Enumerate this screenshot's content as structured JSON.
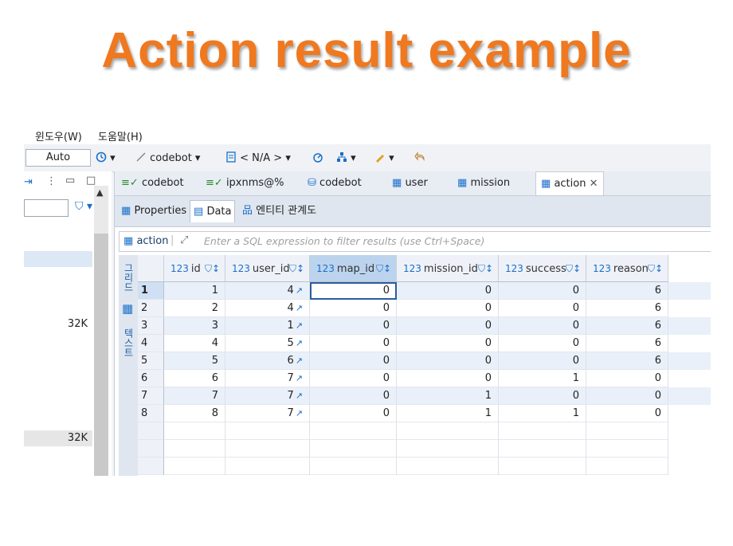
{
  "slide_title": "Action result example",
  "menu": {
    "window": "윈도우(W)",
    "help": "도움말(H)"
  },
  "toolbar": {
    "auto": "Auto",
    "connection": "codebot",
    "schema": "< N/A >"
  },
  "left_panel": {
    "value_1": "32K",
    "value_2": "32K"
  },
  "editor_tabs": [
    {
      "label": "codebot"
    },
    {
      "label": "ipxnms@%"
    },
    {
      "label": "codebot"
    },
    {
      "label": "user"
    },
    {
      "label": "mission"
    },
    {
      "label": "action"
    }
  ],
  "sub_tabs": {
    "properties": "Properties",
    "data": "Data",
    "er": "엔티티 관계도"
  },
  "filter": {
    "table": "action",
    "placeholder": "Enter a SQL expression to filter results (use Ctrl+Space)"
  },
  "side_labels": {
    "grid": "그리드",
    "text": "텍스트"
  },
  "columns": [
    {
      "type": "123",
      "name": "id"
    },
    {
      "type": "123",
      "name": "user_id"
    },
    {
      "type": "123",
      "name": "map_id"
    },
    {
      "type": "123",
      "name": "mission_id"
    },
    {
      "type": "123",
      "name": "success"
    },
    {
      "type": "123",
      "name": "reason"
    }
  ],
  "rows": [
    {
      "n": "1",
      "id": "1",
      "user_id": "4",
      "map_id": "0",
      "mission_id": "0",
      "success": "0",
      "reason": "6"
    },
    {
      "n": "2",
      "id": "2",
      "user_id": "4",
      "map_id": "0",
      "mission_id": "0",
      "success": "0",
      "reason": "6"
    },
    {
      "n": "3",
      "id": "3",
      "user_id": "1",
      "map_id": "0",
      "mission_id": "0",
      "success": "0",
      "reason": "6"
    },
    {
      "n": "4",
      "id": "4",
      "user_id": "5",
      "map_id": "0",
      "mission_id": "0",
      "success": "0",
      "reason": "6"
    },
    {
      "n": "5",
      "id": "5",
      "user_id": "6",
      "map_id": "0",
      "mission_id": "0",
      "success": "0",
      "reason": "6"
    },
    {
      "n": "6",
      "id": "6",
      "user_id": "7",
      "map_id": "0",
      "mission_id": "0",
      "success": "1",
      "reason": "0"
    },
    {
      "n": "7",
      "id": "7",
      "user_id": "7",
      "map_id": "0",
      "mission_id": "1",
      "success": "0",
      "reason": "0"
    },
    {
      "n": "8",
      "id": "8",
      "user_id": "7",
      "map_id": "0",
      "mission_id": "1",
      "success": "1",
      "reason": "0"
    }
  ]
}
